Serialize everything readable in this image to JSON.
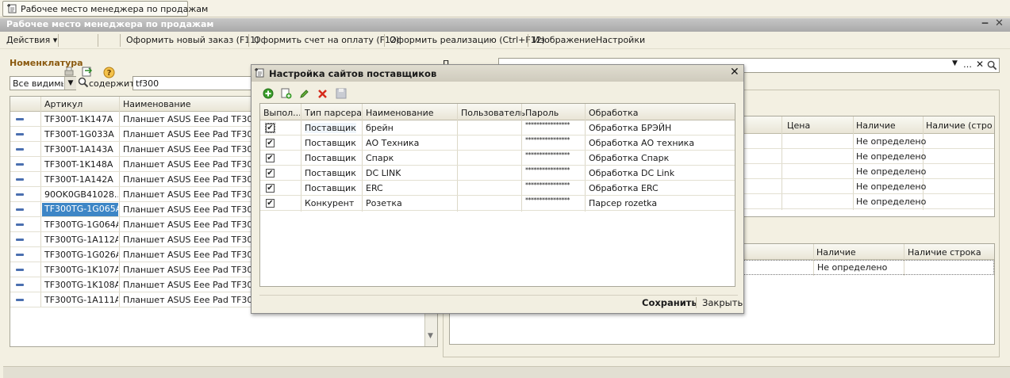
{
  "tab": {
    "label": "Рабочее место менеджера по продажам"
  },
  "window": {
    "title": "Рабочее место менеджера по продажам",
    "min_glyph": "‒",
    "close_glyph": "✕"
  },
  "toolbar": {
    "actions": "Действия",
    "new_order": "Оформить новый заказ (F11)",
    "invoice": "Оформить счет на оплату (F12)",
    "realization": "Оформить реализацию (Ctrl+F12)",
    "image": "Изображение",
    "settings": "Настройки"
  },
  "left": {
    "group_title": "Номенклатура",
    "filter_value": "Все видимые",
    "contains_label": "содержит:",
    "search_value": "tf300",
    "columns": [
      "Артикул",
      "Наименование"
    ],
    "rows": [
      {
        "code": "TF300T-1K147A",
        "name": "Планшет ASUS Eee Pad TF3001"
      },
      {
        "code": "TF300T-1G033A",
        "name": "Планшет ASUS Eee Pad TF3001"
      },
      {
        "code": "TF300T-1A143A",
        "name": "Планшет ASUS Eee Pad TF3001"
      },
      {
        "code": "TF300T-1K148A",
        "name": "Планшет ASUS Eee Pad TF3001"
      },
      {
        "code": "TF300T-1A142A",
        "name": "Планшет ASUS Eee Pad TF3001"
      },
      {
        "code": "90OK0GB41028...",
        "name": "Планшет ASUS Eee Pad TF3001"
      },
      {
        "code": "TF300TG-1G065A",
        "name": "Планшет ASUS Eee Pad TF3001"
      },
      {
        "code": "TF300TG-1G064A",
        "name": "Планшет ASUS Eee Pad TF3001"
      },
      {
        "code": "TF300TG-1A112A",
        "name": "Планшет ASUS Eee Pad TF3001"
      },
      {
        "code": "TF300TG-1G026A",
        "name": "Планшет ASUS Eee Pad TF3001"
      },
      {
        "code": "TF300TG-1K107A",
        "name": "Планшет ASUS Eee Pad TF3001"
      },
      {
        "code": "TF300TG-1K108A",
        "name": "Планшет ASUS Eee Pad TF3001"
      },
      {
        "code": "TF300TG-1A111A",
        "name": "Планшет ASUS Eee Pad TF3001"
      }
    ],
    "selected_index": 6
  },
  "right": {
    "label_partial": "П",
    "upper_columns": [
      "Цена",
      "Наличие",
      "Наличие (стро..."
    ],
    "upper_rows": [
      "Не определено",
      "Не определено",
      "Не определено",
      "Не определено",
      "Не определено"
    ],
    "lower_columns": [
      "Наличие",
      "Наличие строка"
    ],
    "lower_rows": [
      "Не определено"
    ]
  },
  "dialog": {
    "title": "Настройка сайтов поставщиков",
    "columns": [
      "Выпол...",
      "Тип парсера",
      "Наименование",
      "Пользователь",
      "Пароль",
      "Обработка"
    ],
    "rows": [
      {
        "checked": true,
        "type": "Поставщик",
        "name": "брейн",
        "user": "",
        "password": "****************",
        "handler": "Обработка БРЭЙН"
      },
      {
        "checked": true,
        "type": "Поставщик",
        "name": "АО Техника",
        "user": "",
        "password": "****************",
        "handler": "Обработка АО техника"
      },
      {
        "checked": true,
        "type": "Поставщик",
        "name": "Спарк",
        "user": "",
        "password": "****************",
        "handler": "Обработка Спарк"
      },
      {
        "checked": true,
        "type": "Поставщик",
        "name": "DC LINK",
        "user": "",
        "password": "****************",
        "handler": "Обработка DC Link"
      },
      {
        "checked": true,
        "type": "Поставщик",
        "name": "ERC",
        "user": "",
        "password": "****************",
        "handler": "Обработка ERC"
      },
      {
        "checked": true,
        "type": "Конкурент",
        "name": "Розетка",
        "user": "",
        "password": "****************",
        "handler": "Парсер rozetka"
      }
    ],
    "save_label": "Сохранить",
    "close_label": "Закрыть",
    "check_glyph": "✔"
  },
  "colors": {
    "group_title": "#8b5a10",
    "selection": "#3d86c6",
    "title_bar": "#a9a9a9",
    "add_icon": "#3a9d2a",
    "delete_icon": "#d62a1a"
  }
}
